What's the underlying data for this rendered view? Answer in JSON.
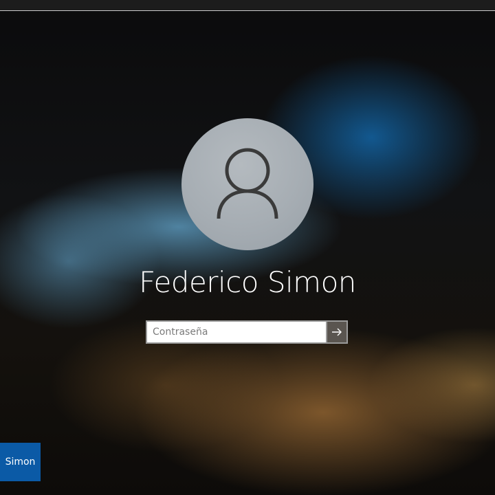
{
  "lock_screen": {
    "user_name": "Federico Simon",
    "avatar_icon": "person-outline-icon",
    "password_field": {
      "placeholder": "Contraseña",
      "value": ""
    },
    "submit_icon": "arrow-right-icon"
  },
  "user_switcher": {
    "tiles": [
      {
        "label": "Simon"
      }
    ]
  },
  "colors": {
    "tile_accent": "#0b5aa6",
    "avatar_bg": "#a6adb3",
    "submit_bg": "#5a5550"
  }
}
